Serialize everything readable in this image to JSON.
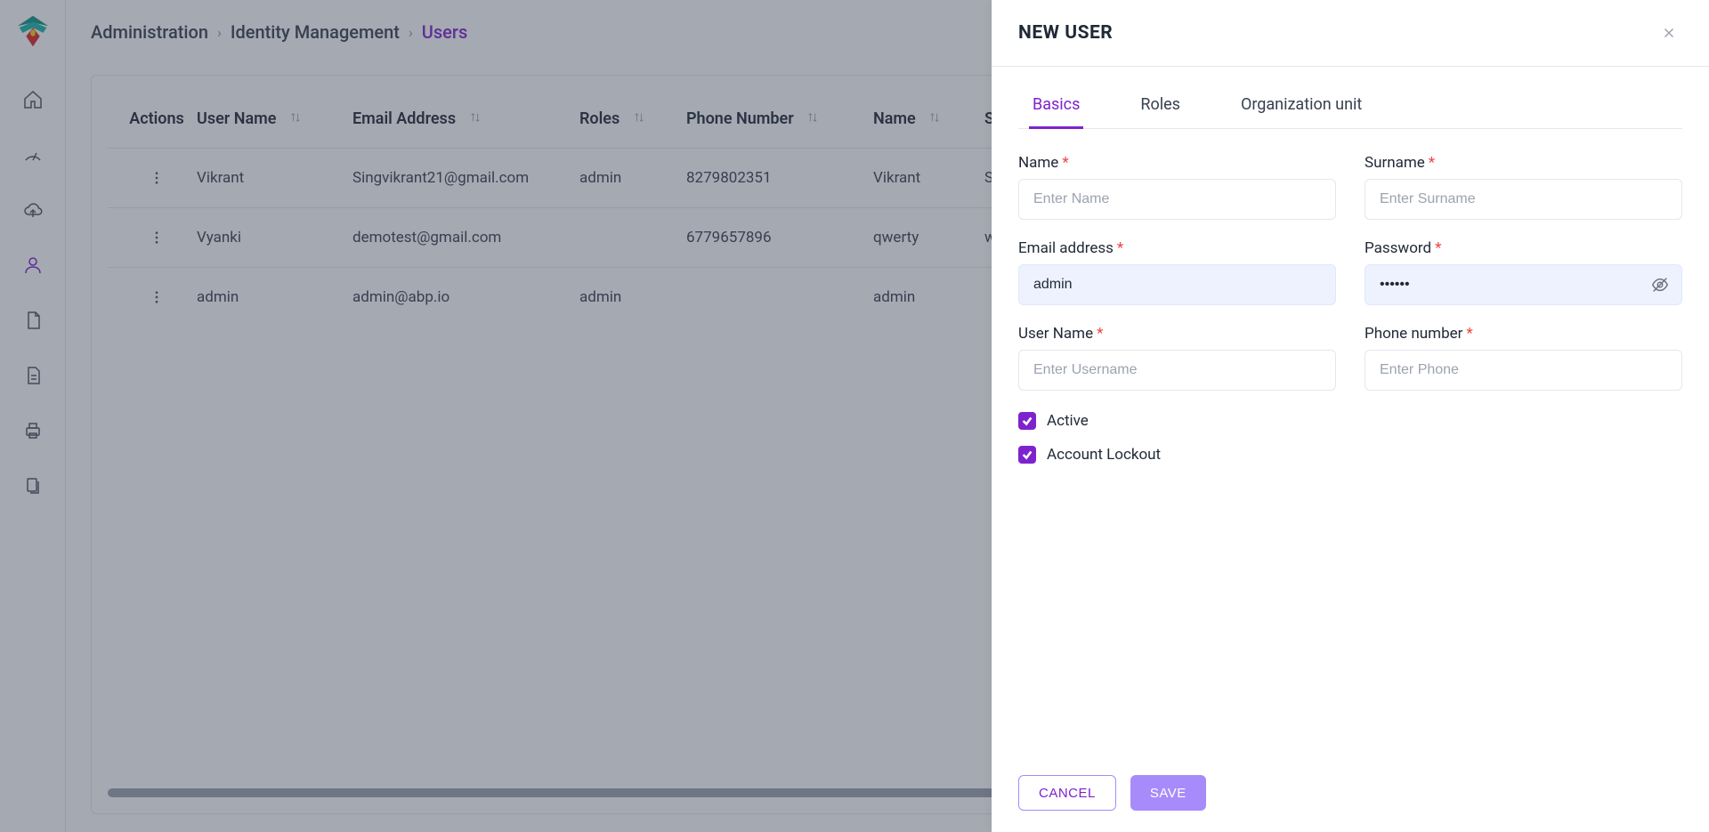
{
  "breadcrumb": {
    "a": "Administration",
    "b": "Identity Management",
    "c": "Users"
  },
  "table": {
    "headers": {
      "actions": "Actions",
      "username": "User Name",
      "email": "Email Address",
      "roles": "Roles",
      "phone": "Phone Number",
      "name": "Name",
      "surname": "Surname"
    },
    "rows": [
      {
        "username": "Vikrant",
        "email": "Singvikrant21@gmail.com",
        "roles": "admin",
        "phone": "8279802351",
        "name": "Vikrant",
        "surname": "Singh"
      },
      {
        "username": "Vyanki",
        "email": "demotest@gmail.com",
        "roles": "",
        "phone": "6779657896",
        "name": "qwerty",
        "surname": "wert"
      },
      {
        "username": "admin",
        "email": "admin@abp.io",
        "roles": "admin",
        "phone": "",
        "name": "admin",
        "surname": ""
      }
    ]
  },
  "drawer": {
    "title": "NEW USER",
    "tabs": {
      "basics": "Basics",
      "roles": "Roles",
      "org": "Organization unit"
    },
    "labels": {
      "name": "Name",
      "surname": "Surname",
      "email": "Email address",
      "password": "Password",
      "username": "User Name",
      "phone": "Phone number",
      "active": "Active",
      "lockout": "Account Lockout"
    },
    "placeholders": {
      "name": "Enter Name",
      "surname": "Enter Surname",
      "username": "Enter Username",
      "phone": "Enter Phone"
    },
    "values": {
      "email": "admin",
      "password": "••••••"
    },
    "buttons": {
      "cancel": "CANCEL",
      "save": "SAVE"
    }
  }
}
